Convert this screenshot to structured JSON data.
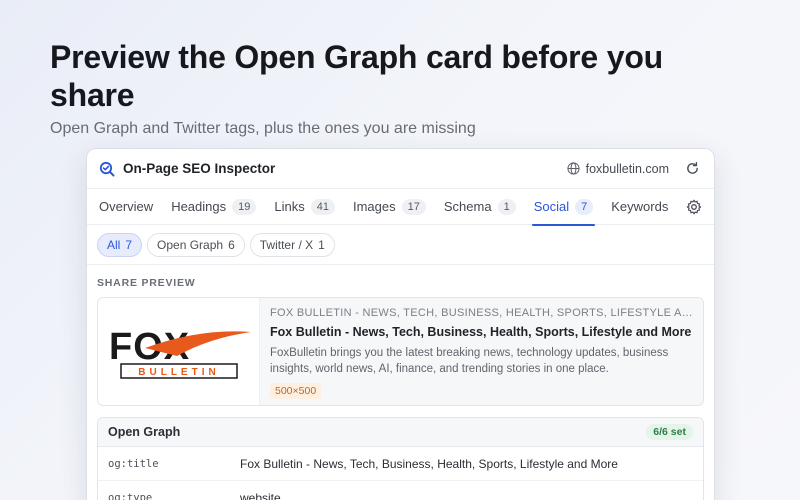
{
  "hero": {
    "headline": "Preview the Open Graph card before you share",
    "subline": "Open Graph and Twitter tags, plus the ones you are missing"
  },
  "app": {
    "title": "On-Page SEO Inspector",
    "domain": "foxbulletin.com"
  },
  "tabs": [
    {
      "label": "Overview",
      "count": null
    },
    {
      "label": "Headings",
      "count": "19"
    },
    {
      "label": "Links",
      "count": "41"
    },
    {
      "label": "Images",
      "count": "17"
    },
    {
      "label": "Schema",
      "count": "1"
    },
    {
      "label": "Social",
      "count": "7",
      "active": true
    },
    {
      "label": "Keywords",
      "count": null
    }
  ],
  "filters": [
    {
      "label": "All",
      "count": "7",
      "active": true
    },
    {
      "label": "Open Graph",
      "count": "6"
    },
    {
      "label": "Twitter / X",
      "count": "1"
    }
  ],
  "share_preview": {
    "section_label": "SHARE PREVIEW",
    "logo_text_top": "FOX",
    "logo_text_bottom": "BULLETIN",
    "site_name": "FOX BULLETIN - NEWS, TECH, BUSINESS, HEALTH, SPORTS, LIFESTYLE AND MORE",
    "title": "Fox Bulletin - News, Tech, Business, Health, Sports, Lifestyle and More",
    "description": "FoxBulletin brings you the latest breaking news, technology updates, business insights, world news, AI, finance, and trending stories in one place.",
    "image_size": "500×500"
  },
  "open_graph": {
    "heading": "Open Graph",
    "status": "6/6 set",
    "rows": [
      {
        "key": "og:title",
        "value": "Fox Bulletin - News, Tech, Business, Health, Sports, Lifestyle and More"
      },
      {
        "key": "og:type",
        "value": "website"
      }
    ]
  },
  "colors": {
    "accent": "#2b56d6",
    "logo_orange": "#e8591c",
    "logo_black": "#1a1a1a",
    "success": "#2f7d4a"
  }
}
